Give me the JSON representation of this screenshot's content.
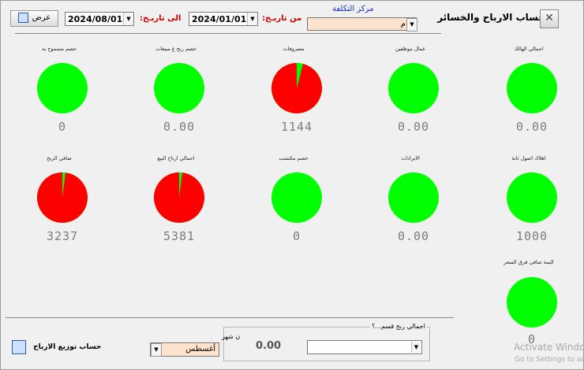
{
  "window": {
    "title": "حساب الارباح والخسائر"
  },
  "filters": {
    "cost_center_label": "مركز التكلفة",
    "cost_center_value": "عام",
    "from_label": "من تاريـخ:",
    "from_date": "2024/01/01",
    "to_label": "الى تاريـخ:",
    "to_date": "2024/08/01",
    "show_button": "عرض"
  },
  "colors": {
    "pie_main": "#00ff00",
    "pie_secondary": "#ff0000"
  },
  "indicators": [
    {
      "label": "اجمالي الهالك",
      "value": "0.00",
      "red_fraction": 0
    },
    {
      "label": "عمال موظفين",
      "value": "0.00",
      "red_fraction": 0
    },
    {
      "label": "مصروفات",
      "value": "1144",
      "red_fraction": 0.96
    },
    {
      "label": "خصم ربح ع مبيعات",
      "value": "0.00",
      "red_fraction": 0
    },
    {
      "label": "خصم مسموح به",
      "value": "0",
      "red_fraction": 0
    },
    {
      "label": "اهلاك اصول ثابة",
      "value": "1000",
      "red_fraction": 0
    },
    {
      "label": "الايرادات",
      "value": "0.00",
      "red_fraction": 0
    },
    {
      "label": "خصم مكتسب",
      "value": "0",
      "red_fraction": 0
    },
    {
      "label": "اجمالي ارباح البيع",
      "value": "5381",
      "red_fraction": 0.98
    },
    {
      "label": "صافي الربح",
      "value": "3237",
      "red_fraction": 0.98
    },
    {
      "label": "اليمة صافي فرق السعر",
      "value": "0",
      "red_fraction": 0
    }
  ],
  "bottom": {
    "total_profit_label": "اجمالي ربح قسم...؟",
    "total_profit_value": "0.00",
    "month_label": "ن شهر",
    "month_value": "أغسطس",
    "distribute_button": "حساب توزيع الارباح"
  },
  "watermark": {
    "line1": "Activate Windo",
    "line2": "Go to Settings to activ"
  }
}
